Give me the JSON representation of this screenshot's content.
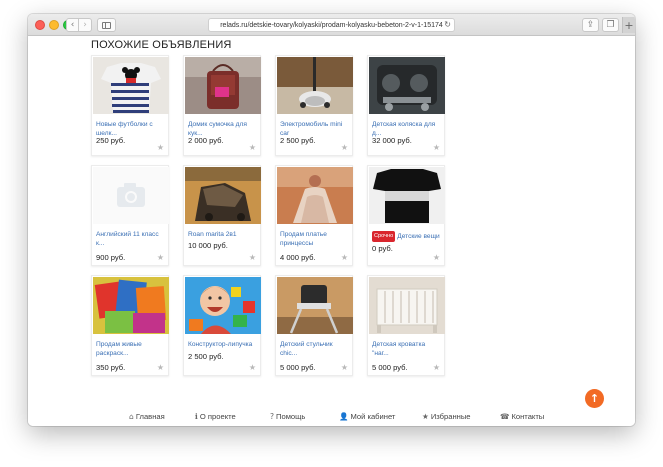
{
  "browser": {
    "url": "relads.ru/detskie-tovary/kolyaski/prodam-kolyasku-bebeton-2-v-1-15174",
    "reload_glyph": "↻",
    "back_glyph": "‹",
    "forward_glyph": "›",
    "share_glyph": "⇪",
    "tabs_glyph": "❐",
    "newtab_glyph": "+"
  },
  "section": {
    "heading": "ПОХОЖИЕ ОБЪЯВЛЕНИЯ"
  },
  "listings": [
    {
      "title": "Новые футболки с шелк...",
      "price": "250 руб.",
      "image": "kids-striped-tshirts-photo"
    },
    {
      "title": "Домик сумочка для кук...",
      "price": "2 000 руб.",
      "image": "pink-doll-bag-photo"
    },
    {
      "title": "Электромобиль mini car",
      "price": "2 500 руб.",
      "image": "kids-scooter-photo"
    },
    {
      "title": "Детская коляска для д...",
      "price": "32 000 руб.",
      "image": "baby-stroller-photo"
    },
    {
      "title": "Английский 11 класс к...",
      "price": "900 руб.",
      "image": "camera-placeholder-icon"
    },
    {
      "title": "Roan marita 2в1",
      "price": "10 000 руб.",
      "image": "stroller-closeup-photo"
    },
    {
      "title": "Продам платье принцессы",
      "price": "4 000 руб.",
      "image": "princess-dress-photo"
    },
    {
      "title": "Детские вещи",
      "price": "0 руб.",
      "image": "kids-clothes-photo",
      "badge": "Срочно"
    },
    {
      "title": "Продам живые раскраск...",
      "price": "350 руб.",
      "image": "coloring-books-photo"
    },
    {
      "title": "Конструктор-липучка",
      "price": "2 500 руб.",
      "image": "smiling-boy-toys-photo"
    },
    {
      "title": "Детский стульчик chic...",
      "price": "5 000 руб.",
      "image": "high-chair-photo"
    },
    {
      "title": "Детская кроватка \"наг...",
      "price": "5 000 руб.",
      "image": "baby-crib-photo"
    }
  ],
  "star_glyph": "★",
  "footer": {
    "links": [
      {
        "label": "Главная",
        "icon": "home-icon",
        "glyph": "⌂"
      },
      {
        "label": "О проекте",
        "icon": "info-icon",
        "glyph": "ℹ"
      },
      {
        "label": "Помощь",
        "icon": "help-icon",
        "glyph": "?"
      },
      {
        "label": "Мой кабинет",
        "icon": "user-icon",
        "glyph": "👤"
      },
      {
        "label": "Избранные",
        "icon": "star-icon",
        "glyph": "★"
      },
      {
        "label": "Контакты",
        "icon": "phone-icon",
        "glyph": "☎"
      }
    ],
    "scroll_top_glyph": "↑"
  },
  "colors": {
    "link": "#3a6fb4",
    "urgent_badge": "#d9262e",
    "scroll_top": "#f26a24"
  }
}
